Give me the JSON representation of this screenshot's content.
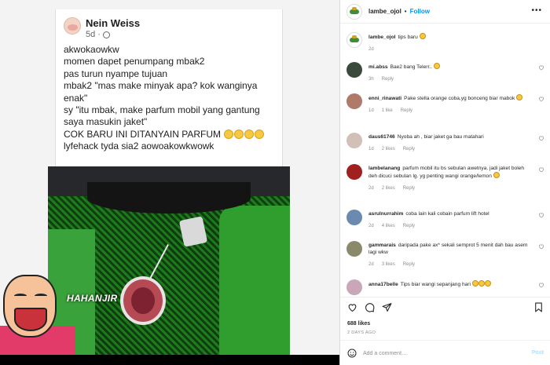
{
  "post_image": {
    "fb_author": "Nein Weiss",
    "fb_time": "5d · ",
    "fb_lines": [
      "akwokaowkw",
      "momen dapet penumpang mbak2",
      "pas turun nyampe tujuan",
      "mbak2 \"mas make minyak apa? kok wanginya enak\"",
      "sy \"itu mbak, make parfum mobil yang gantung saya masukin jaket\"",
      "COK BARU INI DITANYAIN PARFUM",
      "lyfehack tyda sia2 aowoakowkwowk"
    ],
    "meme_caption": "HAHANJIR"
  },
  "sidebar": {
    "header": {
      "username": "lambe_ojol",
      "separator": "•",
      "follow_label": "Follow"
    },
    "caption": {
      "username": "lambe_ojol",
      "text": "tips baru",
      "time": "2d"
    },
    "comments": [
      {
        "user": "mi.abss",
        "text": "Bae2 bang Telerr..",
        "time": "3h",
        "likes": "",
        "reply": "Reply"
      },
      {
        "user": "enni_rinawati",
        "text": "Pake stella orange coba,yg bonceng biar mabok",
        "time": "1d",
        "likes": "1 like",
        "reply": "Reply"
      },
      {
        "user": "daus61746",
        "text": "Nyoba ah , biar jaket ga bau matahari",
        "time": "1d",
        "likes": "2 likes",
        "reply": "Reply"
      },
      {
        "user": "lambelanang",
        "text": "parfum mobil itu bs sebulan awetnya. jadi jaket boleh deh dicuci sebulan lg. yg penting wangi orange/lemon",
        "time": "2d",
        "likes": "2 likes",
        "reply": "Reply"
      },
      {
        "user": "asrulnurrahim",
        "text": "coba lain kali cobain parfum lift hotel",
        "time": "2d",
        "likes": "4 likes",
        "reply": "Reply"
      },
      {
        "user": "gammarais",
        "text": "daripada pake ax* sekali semprot 5 menit dah bau asem lagi wkw",
        "time": "2d",
        "likes": "3 likes",
        "reply": "Reply"
      },
      {
        "user": "anna17belle",
        "text": "Tips biar wangi sepanjang hari",
        "time": "",
        "likes": "",
        "reply": ""
      }
    ],
    "likes_count": "688 likes",
    "time_ago": "2 DAYS AGO",
    "comment_input": {
      "placeholder": "Add a comment…",
      "value": ""
    },
    "post_label": "Post"
  },
  "icons": {
    "heart": "heart-icon",
    "comment": "comment-icon",
    "share": "share-icon",
    "save": "bookmark-icon",
    "emoji": "smile-icon",
    "more": "more-icon"
  },
  "colors": {
    "follow": "#0095f6",
    "post_disabled": "#b2dffc",
    "muted": "#8e8e8e"
  }
}
